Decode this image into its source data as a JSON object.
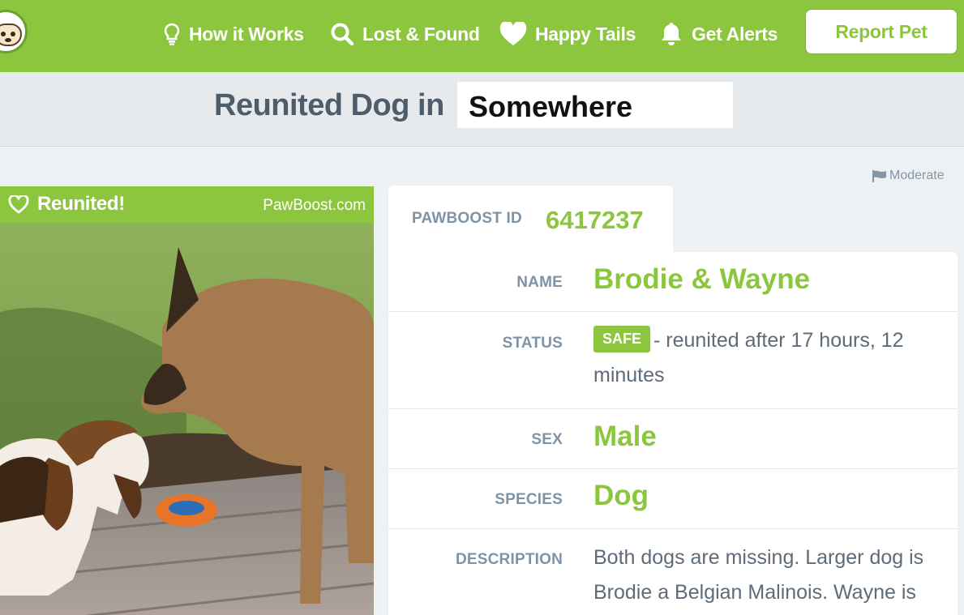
{
  "nav": {
    "how_it_works": "How it Works",
    "lost_found": "Lost & Found",
    "happy_tails": "Happy Tails",
    "get_alerts": "Get Alerts",
    "report_pet": "Report Pet",
    "icons": [
      "lightbulb-icon",
      "search-icon",
      "heart-icon",
      "bell-icon"
    ]
  },
  "header": {
    "title": "Reunited Dog in",
    "location": "Somewhere"
  },
  "moderate": {
    "label": "Moderate",
    "icon": "flag-icon"
  },
  "photo_card": {
    "badge": "Reunited!",
    "badge_icon": "heart-outline-icon",
    "brand": "PawBoost.com"
  },
  "pet": {
    "id_label": "PAWBOOST ID",
    "id": "6417237",
    "fields": {
      "name_label": "NAME",
      "name": "Brodie & Wayne",
      "status_label": "STATUS",
      "status_badge": "SAFE",
      "status_text": "- reunited after 17 hours, 12 minutes",
      "sex_label": "SEX",
      "sex": "Male",
      "species_label": "SPECIES",
      "species": "Dog",
      "description_label": "DESCRIPTION",
      "description": "Both dogs are missing. Larger dog is Brodie a Belgian Malinois. Wayne is the"
    }
  },
  "colors": {
    "brand_green": "#8cc63f",
    "title_gray": "#4f5d6b",
    "label_gray": "#7f93a7",
    "band_bg": "#e6eaed"
  }
}
